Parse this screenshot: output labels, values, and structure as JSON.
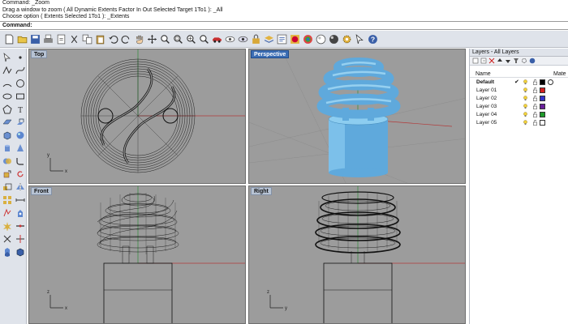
{
  "command_history": [
    "Command: _Zoom",
    "Drag a window to zoom ( All  Dynamic  Extents  Factor  In  Out  Selected  Target  1To1 ): _All",
    "Choose option ( Extents  Selected  1To1 ): _Extents"
  ],
  "command_prompt": {
    "label": "Command:",
    "value": ""
  },
  "toolbar_icons": [
    "new-icon",
    "open-icon",
    "save-icon",
    "print-icon",
    "import-icon",
    "cut-icon",
    "copy-icon",
    "paste-icon",
    "undo-icon",
    "redo-icon",
    "pan-hand-icon",
    "rotate-view-icon",
    "zoom-icon",
    "zoom-window-icon",
    "zoom-extents-icon",
    "zoom-selected-icon",
    "car-icon",
    "hide-icon",
    "show-icon",
    "lock-icon",
    "layer-icon",
    "properties-icon",
    "render-sphere-icon",
    "material-icon",
    "environment-icon",
    "light-icon",
    "settings-gear-icon",
    "select-icon",
    "help-icon"
  ],
  "left_tools": [
    "pointer-icon",
    "point-icon",
    "polyline-icon",
    "curve-icon",
    "arc-icon",
    "circle-icon",
    "ellipse-icon",
    "rectangle-icon",
    "polygon-icon",
    "text-icon",
    "surface-icon",
    "extrude-icon",
    "box-icon",
    "sphere-icon",
    "cylinder-icon",
    "cone-icon",
    "boolean-icon",
    "fillet-icon",
    "move-icon",
    "rotate-icon",
    "scale-icon",
    "mirror-icon",
    "array-icon",
    "dimension-icon",
    "analyze-icon",
    "render-icon",
    "explode-icon",
    "join-icon",
    "trim-icon",
    "split-icon",
    "group-icon",
    "block-icon"
  ],
  "viewports": {
    "top": "Top",
    "perspective": "Perspective",
    "front": "Front",
    "right": "Right"
  },
  "layers_panel": {
    "title": "Layers - All Layers",
    "col_name": "Name",
    "col_material": "Mate",
    "layers": [
      {
        "name": "Default",
        "current": true,
        "color": "#000000"
      },
      {
        "name": "Layer 01",
        "current": false,
        "color": "#d42020"
      },
      {
        "name": "Layer 02",
        "current": false,
        "color": "#3333cc"
      },
      {
        "name": "Layer 03",
        "current": false,
        "color": "#6a1f9a"
      },
      {
        "name": "Layer 04",
        "current": false,
        "color": "#1f9a2a"
      },
      {
        "name": "Layer 05",
        "current": false,
        "color": "#ffffff"
      }
    ]
  },
  "colors": {
    "viewport_bg": "#9c9c9c",
    "wireframe": "#111111",
    "bulb_shaded": "#67b6e6",
    "active_title": "#3b6db4",
    "axis_x": "#c43030",
    "axis_y": "#2f9a3a"
  }
}
